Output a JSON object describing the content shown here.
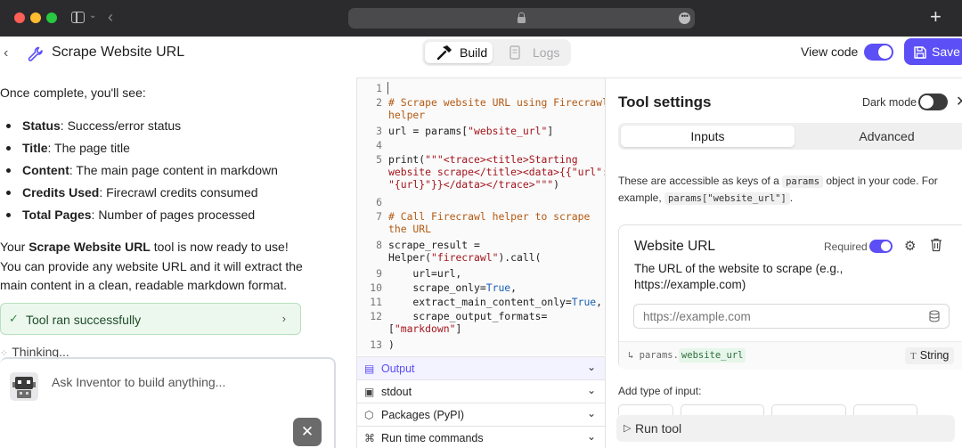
{
  "browser": {
    "more_glyph": "•••",
    "new_tab_glyph": "+"
  },
  "header": {
    "title": "Scrape Website URL",
    "build_label": "Build",
    "logs_label": "Logs",
    "view_code_label": "View code",
    "view_code_on": true,
    "save_label": "Save",
    "accent": "#5b4ff5"
  },
  "chat": {
    "intro": "Once complete, you'll see:",
    "bullets": [
      {
        "term": "Status",
        "text": ": Success/error status"
      },
      {
        "term": "Title",
        "text": ": The page title"
      },
      {
        "term": "Content",
        "text": ": The main page content in markdown"
      },
      {
        "term": "Credits Used",
        "text": ": Firecrawl credits consumed"
      },
      {
        "term": "Total Pages",
        "text": ": Number of pages processed"
      }
    ],
    "ready_pre": "Your ",
    "ready_bold": "Scrape Website URL",
    "ready_post": " tool is now ready to use! You can provide any website URL and it will extract the main content in a clean, readable markdown format.",
    "ran_label": "Tool ran successfully",
    "thinking": "Thinking...",
    "composer_placeholder": "Ask Inventor to build anything...",
    "close_glyph": "✕"
  },
  "code": {
    "line_numbers": [
      "1",
      "2",
      "3",
      "4",
      "5",
      "6",
      "7",
      "8",
      "9",
      "10",
      "11",
      "12",
      "13"
    ]
  },
  "accordion": [
    {
      "icon": "output-icon",
      "label": "Output",
      "active": true
    },
    {
      "icon": "terminal-icon",
      "label": "stdout",
      "active": false
    },
    {
      "icon": "package-icon",
      "label": "Packages (PyPI)",
      "active": false
    },
    {
      "icon": "command-icon",
      "label": "Run time commands",
      "active": false
    }
  ],
  "settings": {
    "title": "Tool settings",
    "dark_mode_label": "Dark mode",
    "dark_mode_on": false,
    "tab_inputs": "Inputs",
    "tab_advanced": "Advanced",
    "desc_pre": "These are accessible as keys of a ",
    "desc_chip1": "params",
    "desc_mid": " object in your code. For example, ",
    "desc_chip2": "params[\"website_url\"]",
    "desc_post": ".",
    "input_card": {
      "title": "Website URL",
      "required_label": "Required",
      "required_on": true,
      "description": "The URL of the website to scrape (e.g., https://example.com)",
      "placeholder": "https://example.com",
      "param_prefix": "params.",
      "param_key": "website_url",
      "type_icon": "T",
      "type_label": "String"
    },
    "add_type_label": "Add type of input:",
    "run_label": "Run tool"
  }
}
